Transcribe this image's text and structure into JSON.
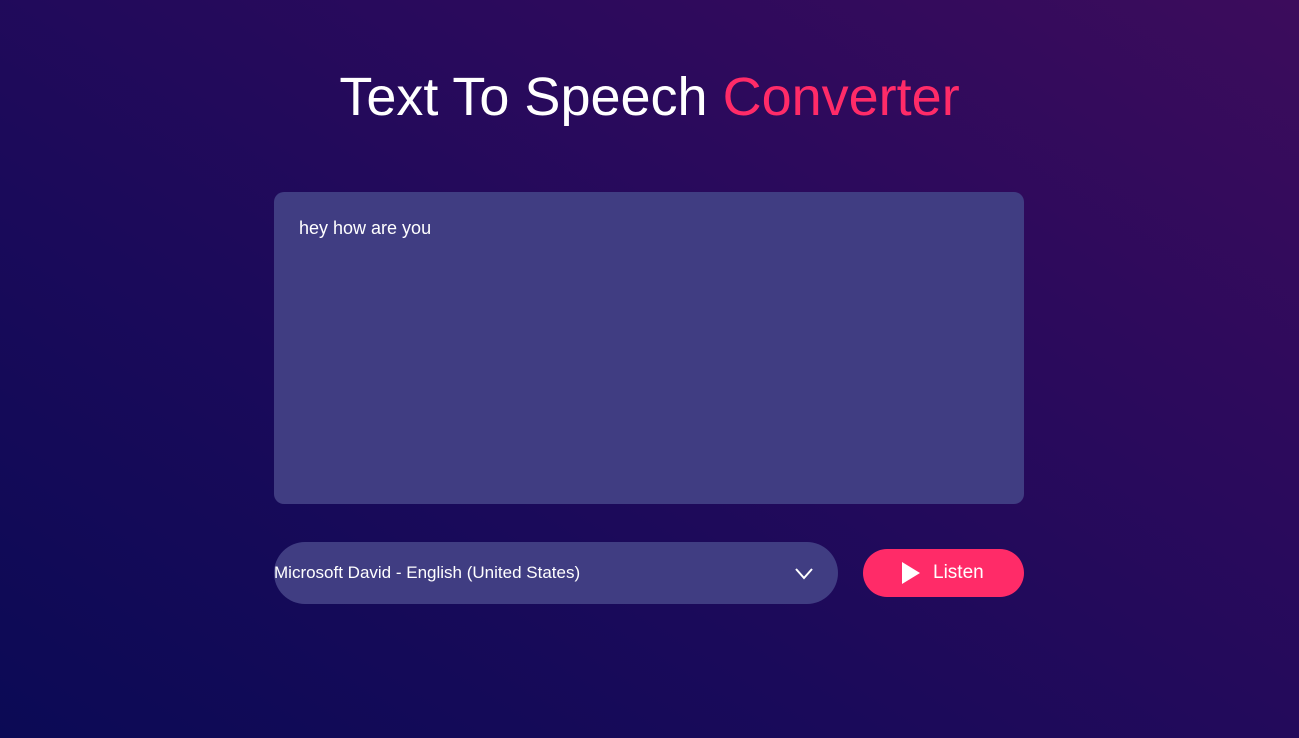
{
  "header": {
    "title_main": "Text To Speech ",
    "title_accent": "Converter"
  },
  "editor": {
    "value": "hey how are you"
  },
  "voice_select": {
    "selected": "Microsoft David - English (United States)"
  },
  "listen_button": {
    "label": "Listen"
  },
  "icons": {
    "chevron": "chevron-down-icon",
    "play": "play-icon"
  },
  "colors": {
    "accent": "#ff2b68",
    "panel": "#403d82",
    "text": "#ffffff"
  }
}
